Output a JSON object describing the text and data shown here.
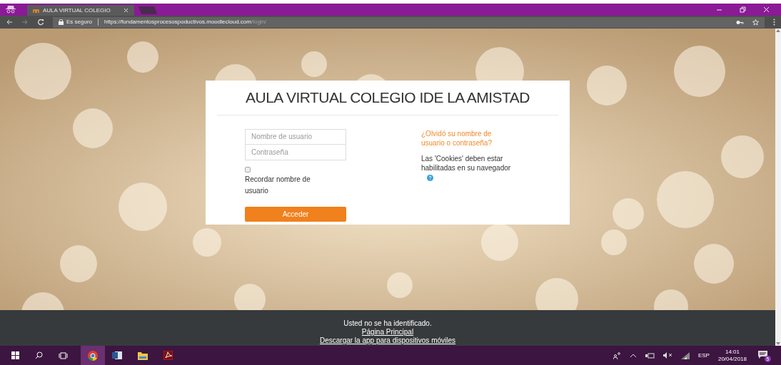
{
  "browser": {
    "tab": {
      "title": "AULA VIRTUAL COLEGIO",
      "selected": true
    },
    "secure_label": "Es seguro",
    "url": {
      "host": "https://fundamentosprocesospoductivos.moodlecloud.com",
      "path": "/login/"
    }
  },
  "login": {
    "title": "AULA VIRTUAL COLEGIO IDE LA AMISTAD",
    "username": {
      "placeholder": "Nombre de usuario"
    },
    "password": {
      "placeholder": "Contraseña"
    },
    "remember": {
      "label": "Recordar nombre de usuario",
      "checked": false
    },
    "submit": "Acceder",
    "forgot_link": "¿Olvidó su nombre de usuario o contraseña?",
    "cookies_note": "Las 'Cookies' deben estar habilitadas en su navegador"
  },
  "footer": {
    "status": "Usted no se ha identificado.",
    "links": [
      "Página Principal",
      "Descargar la app para dispositivos móviles"
    ]
  },
  "taskbar": {
    "language": "ESP",
    "time": "14:01",
    "date": "20/04/2018",
    "notifications": "5"
  }
}
